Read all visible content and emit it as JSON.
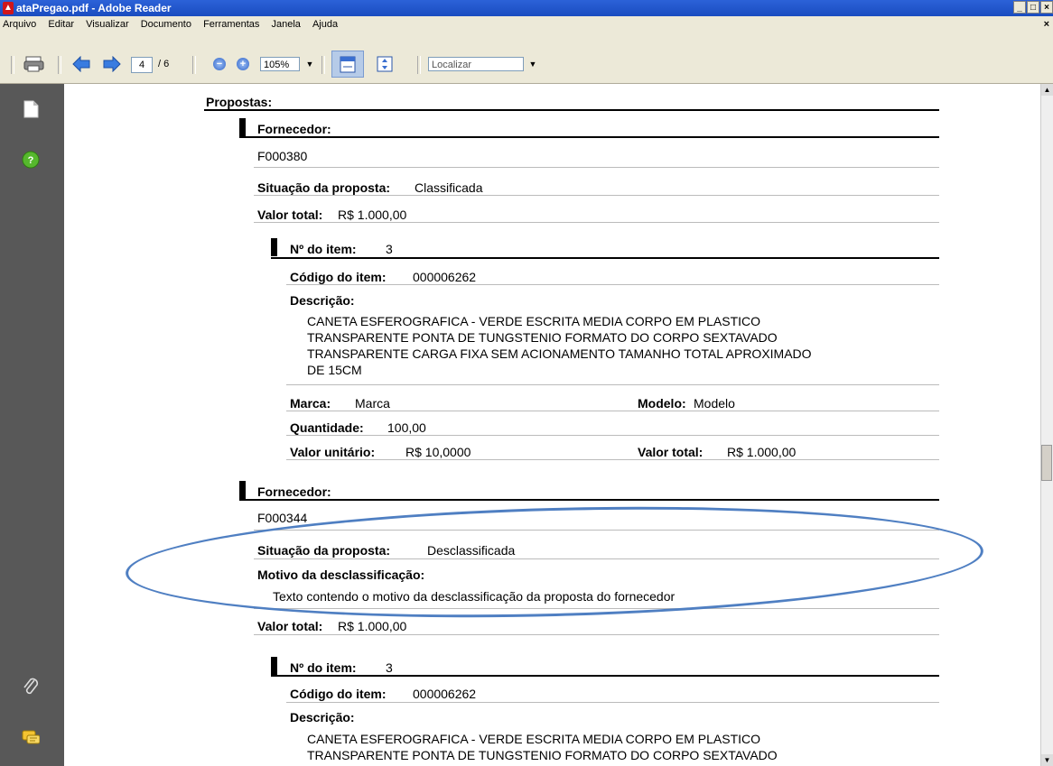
{
  "window": {
    "title": "ataPregao.pdf - Adobe Reader",
    "buttons": [
      "_",
      "□",
      "×"
    ]
  },
  "menu": {
    "items": [
      "Arquivo",
      "Editar",
      "Visualizar",
      "Documento",
      "Ferramentas",
      "Janela",
      "Ajuda"
    ],
    "close": "×"
  },
  "toolbar": {
    "page_current": "4",
    "page_total": "/ 6",
    "zoom": "105%",
    "find_placeholder": "Localizar"
  },
  "doc": {
    "section_title": "Propostas:",
    "supplier1": {
      "header": "Fornecedor:",
      "code": "F000380",
      "status_label": "Situação da proposta:",
      "status_value": "Classificada",
      "total_label": "Valor total:",
      "total_value": "R$ 1.000,00",
      "item": {
        "number_label": "Nº do item:",
        "number_value": "3",
        "code_label": "Código do item:",
        "code_value": "000006262",
        "desc_label": "Descrição:",
        "desc_lines": [
          "CANETA ESFEROGRAFICA -  VERDE ESCRITA MEDIA CORPO EM PLASTICO",
          "TRANSPARENTE PONTA DE TUNGSTENIO FORMATO DO CORPO SEXTAVADO",
          "TRANSPARENTE CARGA FIXA  SEM ACIONAMENTO TAMANHO TOTAL APROXIMADO",
          "DE 15CM"
        ],
        "brand_label": "Marca:",
        "brand_value": "Marca",
        "model_label": "Modelo:",
        "model_value": "Modelo",
        "qty_label": "Quantidade:",
        "qty_value": "100,00",
        "unit_label": "Valor unitário:",
        "unit_value": "R$ 10,0000",
        "item_total_label": "Valor total:",
        "item_total_value": "R$ 1.000,00"
      }
    },
    "supplier2": {
      "header": "Fornecedor:",
      "code": "F000344",
      "status_label": "Situação da proposta:",
      "status_value": "Desclassificada",
      "reason_label": "Motivo da desclassificação:",
      "reason_value": "Texto contendo o motivo da desclassificação da proposta do fornecedor",
      "total_label": "Valor total:",
      "total_value": "R$ 1.000,00",
      "item": {
        "number_label": "Nº do item:",
        "number_value": "3",
        "code_label": "Código do item:",
        "code_value": "000006262",
        "desc_label": "Descrição:",
        "desc_lines": [
          "CANETA ESFEROGRAFICA -  VERDE ESCRITA MEDIA CORPO EM PLASTICO",
          "TRANSPARENTE PONTA DE TUNGSTENIO FORMATO DO CORPO SEXTAVADO"
        ]
      }
    }
  }
}
